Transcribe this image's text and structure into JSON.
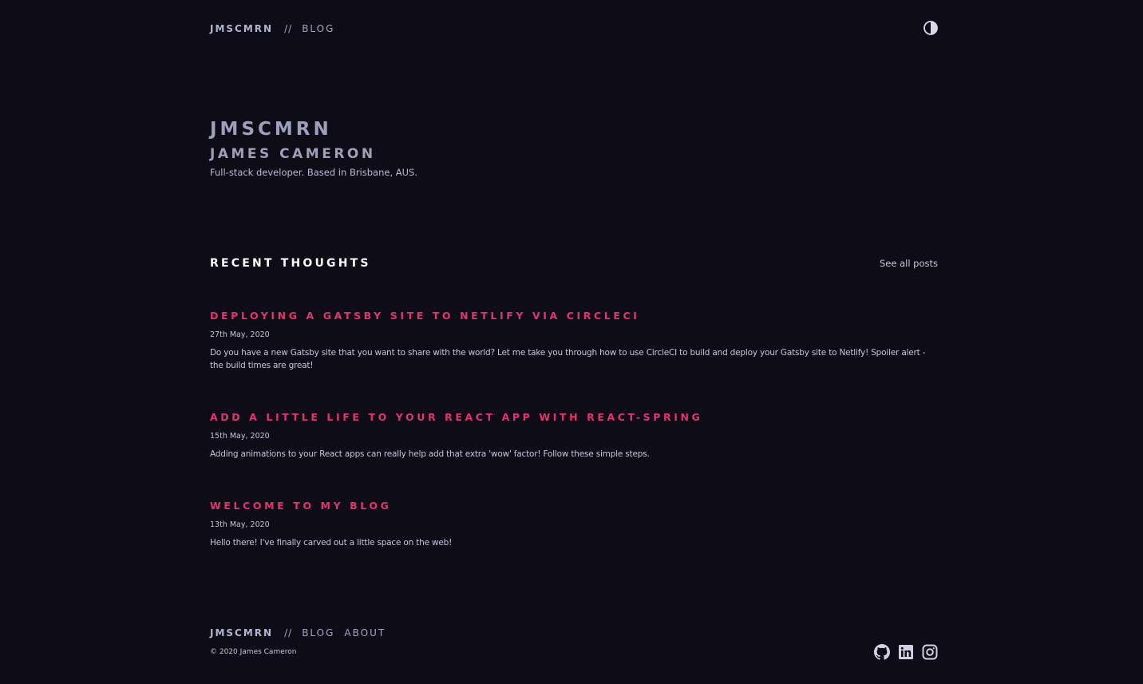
{
  "header": {
    "brand": "JMSCMRN",
    "separator": "//",
    "section_link": "BLOG"
  },
  "hero": {
    "handle": "JMSCMRN",
    "name": "JAMES CAMERON",
    "tagline": "Full-stack developer. Based in Brisbane, AUS."
  },
  "recent": {
    "title": "RECENT THOUGHTS",
    "see_all": "See all posts",
    "posts": [
      {
        "title": "DEPLOYING A GATSBY SITE TO NETLIFY VIA CIRCLECI",
        "date": "27th May, 2020",
        "excerpt": "Do you have a new Gatsby site that you want to share with the world? Let me take you through how to use CircleCI to build and deploy your Gatsby site to Netlify! Spoiler alert - the build times are great!"
      },
      {
        "title": "ADD A LITTLE LIFE TO YOUR REACT APP WITH REACT-SPRING",
        "date": "15th May, 2020",
        "excerpt": "Adding animations to your React apps can really help add that extra 'wow' factor! Follow these simple steps."
      },
      {
        "title": "WELCOME TO MY BLOG",
        "date": "13th May, 2020",
        "excerpt": "Hello there! I've finally carved out a little space on the web!"
      }
    ]
  },
  "footer": {
    "brand": "JMSCMRN",
    "separator": "//",
    "links": [
      "BLOG",
      "ABOUT"
    ],
    "copyright": "© 2020 James Cameron",
    "socials": [
      "github-icon",
      "linkedin-icon",
      "instagram-icon"
    ]
  },
  "colors": {
    "background": "#0e0d17",
    "accent": "#e4336d",
    "muted": "#a3a4c0"
  }
}
